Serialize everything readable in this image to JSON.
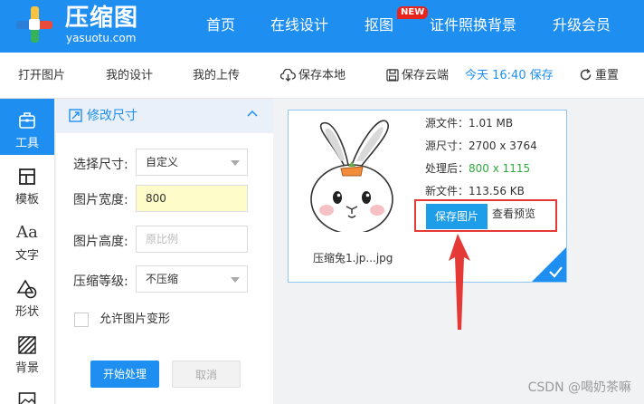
{
  "brand": {
    "title": "压缩图",
    "subtitle": "yasuotu.com"
  },
  "nav": {
    "items": [
      {
        "label": "首页"
      },
      {
        "label": "在线设计"
      },
      {
        "label": "抠图"
      },
      {
        "label": "证件照换背景"
      },
      {
        "label": "升级会员"
      }
    ],
    "badge": "NEW"
  },
  "toolbar": {
    "open": "打开图片",
    "my_designs": "我的设计",
    "my_uploads": "我的上传",
    "save_local": "保存本地",
    "save_cloud": "保存云端",
    "saved_time": "今天 16:40 保存",
    "reset": "重置"
  },
  "rail": {
    "items": [
      {
        "label": "工具",
        "icon": "toolbox-icon"
      },
      {
        "label": "模板",
        "icon": "template-icon"
      },
      {
        "label": "文字",
        "icon": "text-icon"
      },
      {
        "label": "形状",
        "icon": "shapes-icon"
      },
      {
        "label": "背景",
        "icon": "background-icon"
      }
    ]
  },
  "panel": {
    "title": "修改尺寸",
    "size_label": "选择尺寸:",
    "size_value": "自定义",
    "width_label": "图片宽度:",
    "width_value": "800",
    "height_label": "图片高度:",
    "height_placeholder": "原比例",
    "level_label": "压缩等级:",
    "level_value": "不压缩",
    "allow_deform": "允许图片变形",
    "start": "开始处理",
    "cancel": "取消"
  },
  "card": {
    "src_file": "源文件：1.01 MB",
    "src_size": "源尺寸：2700 x 3764",
    "processed_label": "处理后：",
    "processed_value": "800 x 1115",
    "new_file": "新文件：113.56 KB",
    "save_btn": "保存图片",
    "preview": "查看预览",
    "filename": "压缩兔1.jp...jpg"
  },
  "watermark": "CSDN @喝奶茶嘛",
  "colors": {
    "primary": "#1e8ff0",
    "highlight_red": "#e53935",
    "green": "#2eaa3c"
  }
}
